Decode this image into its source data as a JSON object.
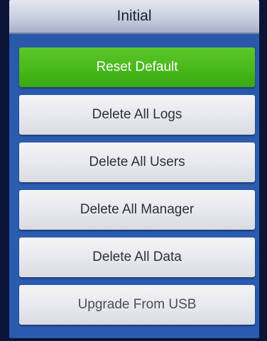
{
  "window": {
    "title": "Initial"
  },
  "menu": {
    "items": [
      {
        "label": "Reset Default",
        "selected": true
      },
      {
        "label": "Delete All Logs",
        "selected": false
      },
      {
        "label": "Delete All Users",
        "selected": false
      },
      {
        "label": "Delete All Manager",
        "selected": false
      },
      {
        "label": "Delete All Data",
        "selected": false
      },
      {
        "label": "Upgrade From USB",
        "selected": false
      }
    ]
  },
  "colors": {
    "selected_bg": "#47b81a",
    "screen_bg": "#2b5cb0",
    "button_bg": "#e6e7ec",
    "title_bar_bg": "#c8cedf"
  }
}
